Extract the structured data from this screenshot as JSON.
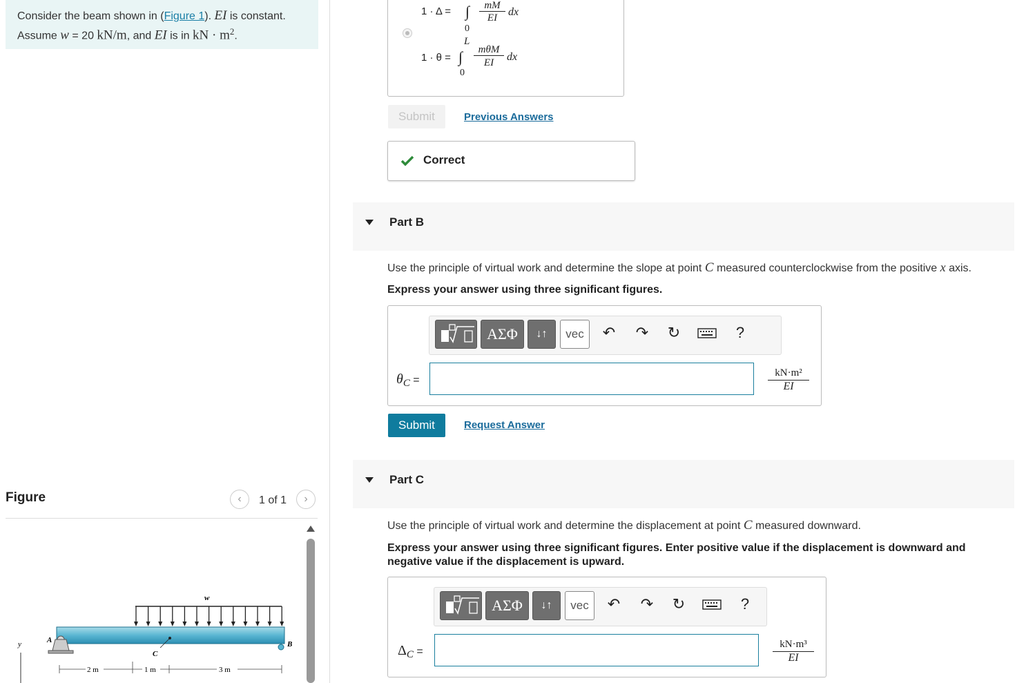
{
  "problem": {
    "line1_prefix": "Consider the beam shown in (",
    "figure_link": "Figure 1",
    "line1_mid": "). ",
    "ei_symbol": "EI",
    "line1_suffix": " is constant.",
    "line2_prefix": "Assume ",
    "w_symbol": "w",
    "line2_eq": " = 20 ",
    "w_unit": "kN/m",
    "line2_and": ", and ",
    "line2_suffix": " is in ",
    "ei_unit": "kN · m",
    "ei_unit_exp": "2",
    "period": "."
  },
  "figure_panel": {
    "title": "Figure",
    "pager_text": "1 of 1",
    "prev_icon": "chevron-left-icon",
    "next_icon": "chevron-right-icon"
  },
  "beam_figure": {
    "load_label": "w",
    "point_a": "A",
    "point_b": "B",
    "point_c": "C",
    "axis_y": "y",
    "dims": [
      "2 m",
      "1 m",
      "3 m"
    ]
  },
  "part_a": {
    "formula1_prefix": "1 · Δ =",
    "formula1_num": "mM",
    "formula1_den": "EI",
    "formula1_dx": "dx",
    "formula1_lower": "0",
    "formula2_upper": "L",
    "formula2_prefix": "1 · θ =",
    "formula2_num": "mθM",
    "formula2_den": "EI",
    "formula2_dx": "dx",
    "formula2_lower": "0",
    "submit_label": "Submit",
    "previous_answers": "Previous Answers",
    "feedback": "Correct"
  },
  "part_b": {
    "label": "Part B",
    "instruction_prefix": "Use the principle of virtual work and determine the slope at point ",
    "point": "C",
    "instruction_mid": " measured counterclockwise from the positive ",
    "axis": "x",
    "instruction_suffix": " axis.",
    "instruction_bold": "Express your answer using three significant figures.",
    "answer_symbol": "θ",
    "answer_sub": "C",
    "answer_eq": "=",
    "input_value": "",
    "unit_num": "kN·m²",
    "unit_den": "EI",
    "submit_label": "Submit",
    "request_answer": "Request Answer",
    "toolbar": {
      "greek": "ΑΣΦ",
      "arrows": "↓↑",
      "vec": "vec",
      "help": "?"
    }
  },
  "part_c": {
    "label": "Part C",
    "instruction_prefix": "Use the principle of virtual work and determine the displacement at point ",
    "point": "C",
    "instruction_suffix": " measured downward.",
    "instruction_bold": "Express your answer using three significant figures. Enter positive value if the displacement is downward and negative value if the displacement is upward.",
    "answer_symbol": "Δ",
    "answer_sub": "C",
    "answer_eq": "=",
    "input_value": "",
    "unit_num": "kN·m³",
    "unit_den": "EI",
    "toolbar": {
      "greek": "ΑΣΦ",
      "arrows": "↓↑",
      "vec": "vec",
      "help": "?"
    }
  },
  "colors": {
    "accent": "#0f7c9e",
    "link": "#1a6b9b",
    "correct": "#2e8b3a",
    "problem_bg": "#e9f5f5"
  }
}
